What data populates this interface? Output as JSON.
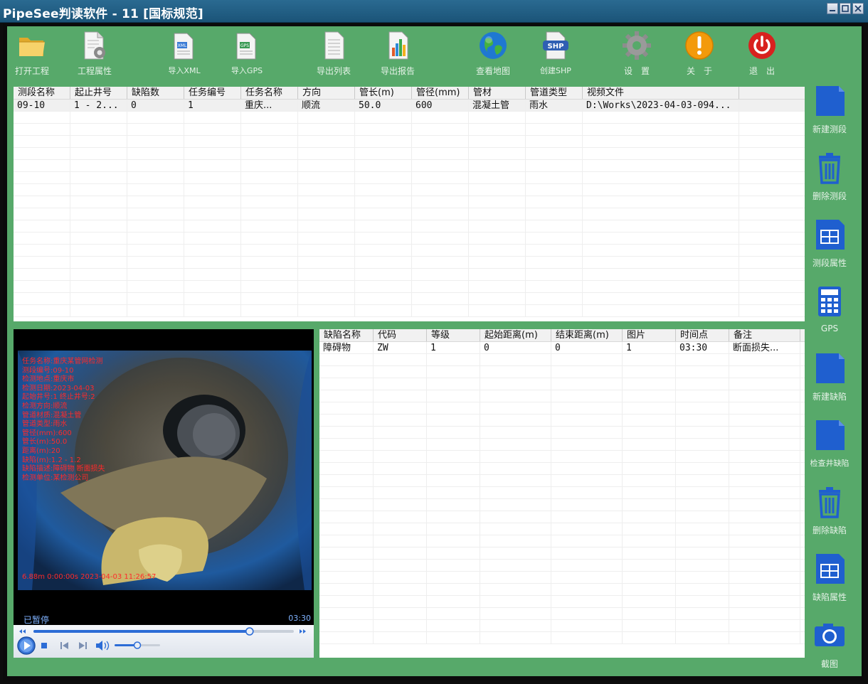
{
  "window": {
    "title": "PipeSee判读软件 - 11 [国标规范]"
  },
  "toolbar": {
    "items": [
      {
        "label": "打开工程",
        "icon": "folder-icon"
      },
      {
        "label": "工程属性",
        "icon": "doc-gear-icon"
      },
      {
        "label": "导入XML",
        "icon": "import-xml-icon"
      },
      {
        "label": "导入GPS",
        "icon": "import-gps-icon"
      },
      {
        "label": "导出列表",
        "icon": "export-list-icon"
      },
      {
        "label": "导出报告",
        "icon": "export-report-icon"
      },
      {
        "label": "查看地图",
        "icon": "globe-icon"
      },
      {
        "label": "创建SHP",
        "icon": "shp-icon"
      },
      {
        "label": "设　置",
        "icon": "gear-icon"
      },
      {
        "label": "关　于",
        "icon": "info-icon"
      },
      {
        "label": "退　出",
        "icon": "power-icon"
      }
    ]
  },
  "segments_table": {
    "headers": [
      "测段名称",
      "起止井号",
      "缺陷数",
      "任务编号",
      "任务名称",
      "方向",
      "管长(m)",
      "管径(mm)",
      "管材",
      "管道类型",
      "视频文件"
    ],
    "rows": [
      [
        "09-10",
        "1 - 2...",
        "0",
        "1",
        "重庆...",
        "顺流",
        "50.0",
        "600",
        "混凝土管",
        "雨水",
        "D:\\Works\\2023-04-03-094..."
      ]
    ]
  },
  "defects_table": {
    "headers": [
      "缺陷名称",
      "代码",
      "等级",
      "起始距离(m)",
      "结束距离(m)",
      "图片",
      "时间点",
      "备注"
    ],
    "rows": [
      [
        "障碍物",
        "ZW",
        "1",
        "0",
        "0",
        "1",
        "03:30",
        "断面损失..."
      ]
    ]
  },
  "video": {
    "overlay_lines": [
      "任务名称:重庆某管网检测",
      "测段编号:09-10",
      "检测地点:重庆市",
      "检测日期:2023-04-03",
      "起始井号:1  终止井号:2",
      "检测方向:顺流",
      "管道材质:混凝土管",
      "管道类型:雨水",
      "管径(mm):600",
      "管长(m):50.0",
      "距离(m):20",
      "缺陷(m):1.2 - 1.2",
      "缺陷描述:障碍物 断面损失",
      "检测单位:某检测公司"
    ],
    "bottom_overlay": "6.88m 0:00:00s  2023-04-03  11:26:57",
    "status": "已暂停",
    "time": "03:30",
    "progress": 0.83,
    "volume": 0.5
  },
  "sidebar": {
    "items": [
      {
        "label": "新建测段",
        "icon": "new-doc-icon"
      },
      {
        "label": "删除测段",
        "icon": "trash-icon"
      },
      {
        "label": "测段属性",
        "icon": "table-icon"
      },
      {
        "label": "GPS",
        "icon": "calculator-icon"
      },
      {
        "label": "新建缺陷",
        "icon": "new-doc-icon"
      },
      {
        "label": "检查井缺陷",
        "icon": "new-doc-icon"
      },
      {
        "label": "删除缺陷",
        "icon": "trash-icon"
      },
      {
        "label": "缺陷属性",
        "icon": "table-icon"
      },
      {
        "label": "截图",
        "icon": "camera-icon"
      }
    ]
  },
  "colors": {
    "panel_green": "#57a96a",
    "titlebar_blue": "#1b5478",
    "side_icon_blue": "#1f5fcf",
    "overlay_red": "#ff2a2a"
  }
}
